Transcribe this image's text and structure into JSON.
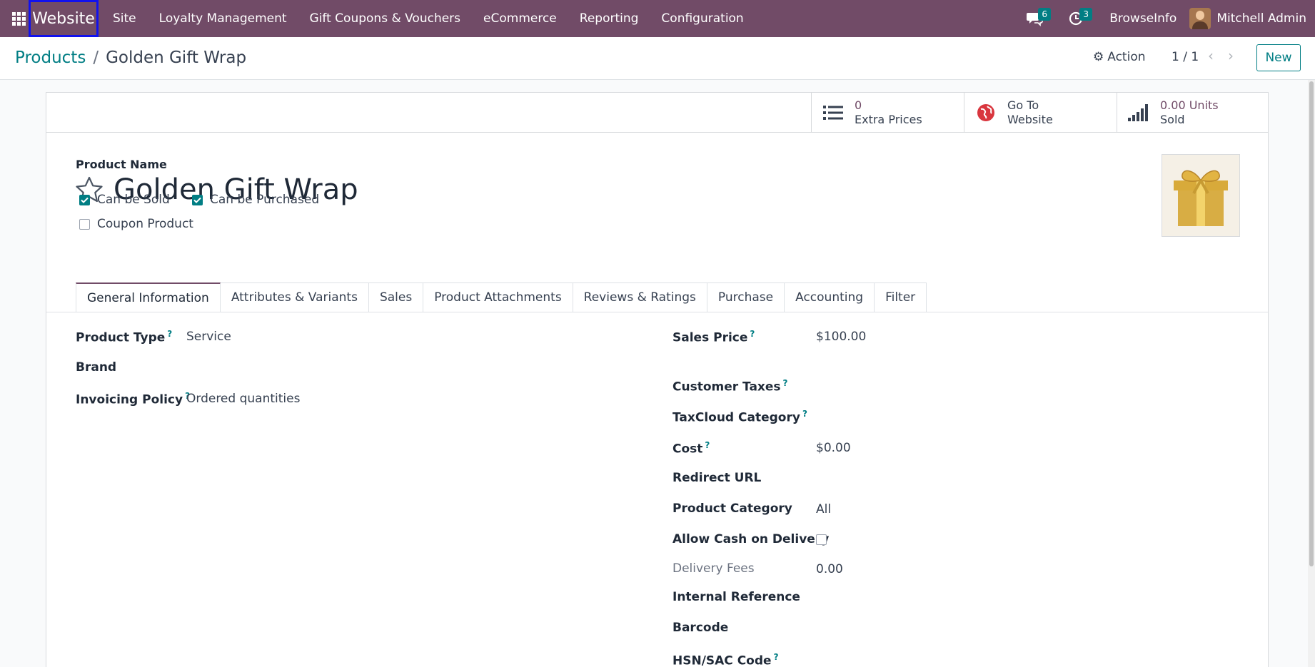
{
  "navbar": {
    "brand": "Website",
    "menu": [
      "Site",
      "Loyalty Management",
      "Gift Coupons & Vouchers",
      "eCommerce",
      "Reporting",
      "Configuration"
    ],
    "messages_count": "6",
    "activities_count": "3",
    "company": "BrowseInfo",
    "user": "Mitchell Admin"
  },
  "control_panel": {
    "breadcrumb_parent": "Products",
    "breadcrumb_separator": "/",
    "breadcrumb_current": "Golden Gift Wrap",
    "action_label": "Action",
    "pager": "1 / 1",
    "new_label": "New"
  },
  "smart_buttons": [
    {
      "value": "0",
      "label": "Extra Prices",
      "icon": "list-icon"
    },
    {
      "value": "Go To",
      "label": "Website",
      "icon": "globe-icon"
    },
    {
      "value": "0.00 Units",
      "label": "Sold",
      "icon": "signal-icon"
    }
  ],
  "product": {
    "name_label": "Product Name",
    "name": "Golden Gift Wrap",
    "checkboxes": [
      {
        "label": "Can be Sold",
        "checked": true
      },
      {
        "label": "Can be Purchased",
        "checked": true
      },
      {
        "label": "Coupon Product",
        "checked": false
      }
    ]
  },
  "tabs": [
    "General Information",
    "Attributes & Variants",
    "Sales",
    "Product Attachments",
    "Reviews & Ratings",
    "Purchase",
    "Accounting",
    "Filter"
  ],
  "left_fields": [
    {
      "label": "Product Type",
      "help": "?",
      "value": "Service"
    },
    {
      "label": "Brand",
      "help": "",
      "value": ""
    },
    {
      "label": "Invoicing Policy",
      "help": "?",
      "value": "Ordered quantities"
    }
  ],
  "right_fields": [
    {
      "label": "Sales Price",
      "help": "?",
      "value": "$100.00"
    },
    {
      "label": "Customer Taxes",
      "help": "?",
      "value": ""
    },
    {
      "label": "TaxCloud Category",
      "help": "?",
      "value": ""
    },
    {
      "label": "Cost",
      "help": "?",
      "value": "$0.00"
    },
    {
      "label": "Redirect URL",
      "help": "",
      "value": ""
    },
    {
      "label": "Product Category",
      "help": "",
      "value": "All"
    },
    {
      "label": "Allow Cash on Delivery",
      "help": "",
      "value": ""
    },
    {
      "label": "Delivery Fees",
      "help": "",
      "value": "0.00"
    },
    {
      "label": "Internal Reference",
      "help": "",
      "value": ""
    },
    {
      "label": "Barcode",
      "help": "",
      "value": ""
    },
    {
      "label": "HSN/SAC Code",
      "help": "?",
      "value": ""
    }
  ],
  "colors": {
    "navbar": "#714b67",
    "accent": "#017e84",
    "highlight_border": "#1111ee"
  }
}
